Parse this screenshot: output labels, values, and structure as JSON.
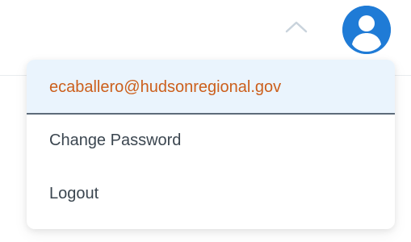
{
  "header": {
    "toggle_icon": "chevron-up-icon",
    "avatar_icon": "user-icon"
  },
  "menu": {
    "email": "ecaballero@hudsonregional.gov",
    "items": [
      {
        "label": "Change Password"
      },
      {
        "label": "Logout"
      }
    ]
  },
  "colors": {
    "avatar": "#1f7bd6",
    "email_text": "#cc5f1c",
    "email_row_bg": "#eaf4fd",
    "menu_text": "#3b4650"
  }
}
